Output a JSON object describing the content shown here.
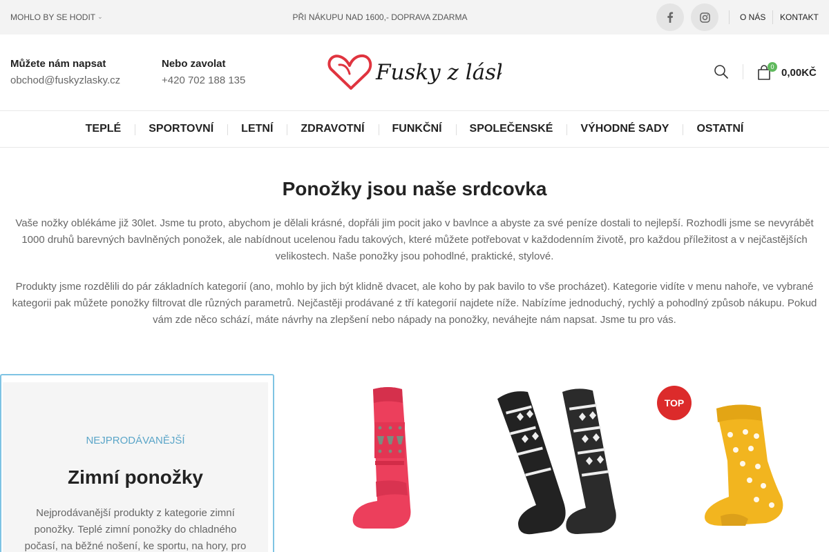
{
  "topbar": {
    "left_menu": "MOHLO BY SE HODIT",
    "promo": "PŘI NÁKUPU NAD 1600,- DOPRAVA ZDARMA",
    "links": [
      "O NÁS",
      "KONTAKT"
    ],
    "social": [
      "facebook-icon",
      "instagram-icon"
    ]
  },
  "header": {
    "write_label": "Můžete nám napsat",
    "email": "obchod@fuskyzlasky.cz",
    "call_label": "Nebo zavolat",
    "phone": "+420 702 188 135",
    "logo_text": "Fusky z lásky",
    "cart_count": "0",
    "cart_total": "0,00KČ",
    "icons": [
      "search-icon",
      "cart-icon"
    ]
  },
  "nav": [
    "TEPLÉ",
    "SPORTOVNÍ",
    "LETNÍ",
    "ZDRAVOTNÍ",
    "FUNKČNÍ",
    "SPOLEČENSKÉ",
    "VÝHODNÉ SADY",
    "OSTATNÍ"
  ],
  "intro": {
    "title": "Ponožky jsou naše srdcovka",
    "p1": "Vaše nožky oblékáme již 30let. Jsme tu proto, abychom je dělali krásné, dopřáli jim pocit jako v bavlnce a abyste za své peníze dostali to nejlepší. Rozhodli jsme se nevyrábět 1000 druhů barevných bavlněných ponožek, ale nabídnout ucelenou řadu takových, které můžete potřebovat v každodenním životě, pro každou příležitost a v nejčastějších velikostech. Naše ponožky jsou pohodlné, praktické, stylové.",
    "p2": "Produkty jsme rozdělili do pár základních kategorií (ano, mohlo by jich být klidně dvacet, ale koho by pak bavilo to vše procházet). Kategorie vidíte v menu nahoře, ve vybrané kategorii pak můžete ponožky filtrovat dle různých parametrů. Nejčastěji prodávané z tří kategorií najdete níže. Nabízíme jednoduchý, rychlý a pohodlný způsob nákupu. Pokud vám zde něco schází, máte návrhy na zlepšení nebo nápady na ponožky, neváhejte nám napsat. Jsme tu pro vás."
  },
  "featured": {
    "kicker": "NEJPRODÁVANĚJŠÍ",
    "title": "Zimní ponožky",
    "desc": "Nejprodávanější produkty z kategorie zimní ponožky. Teplé zimní ponožky do chladného počasí, na běžné nošení, ke sportu, na hory, pro"
  },
  "products": {
    "badge": "TOP",
    "colors": {
      "pink": "#ec3f5c",
      "black": "#222222",
      "yellow": "#f2b51f"
    }
  },
  "colors": {
    "accent_blue": "#7ec3e3",
    "badge_red": "#dc2b2b",
    "cart_green": "#5fb95d",
    "logo_red": "#e0343f"
  }
}
